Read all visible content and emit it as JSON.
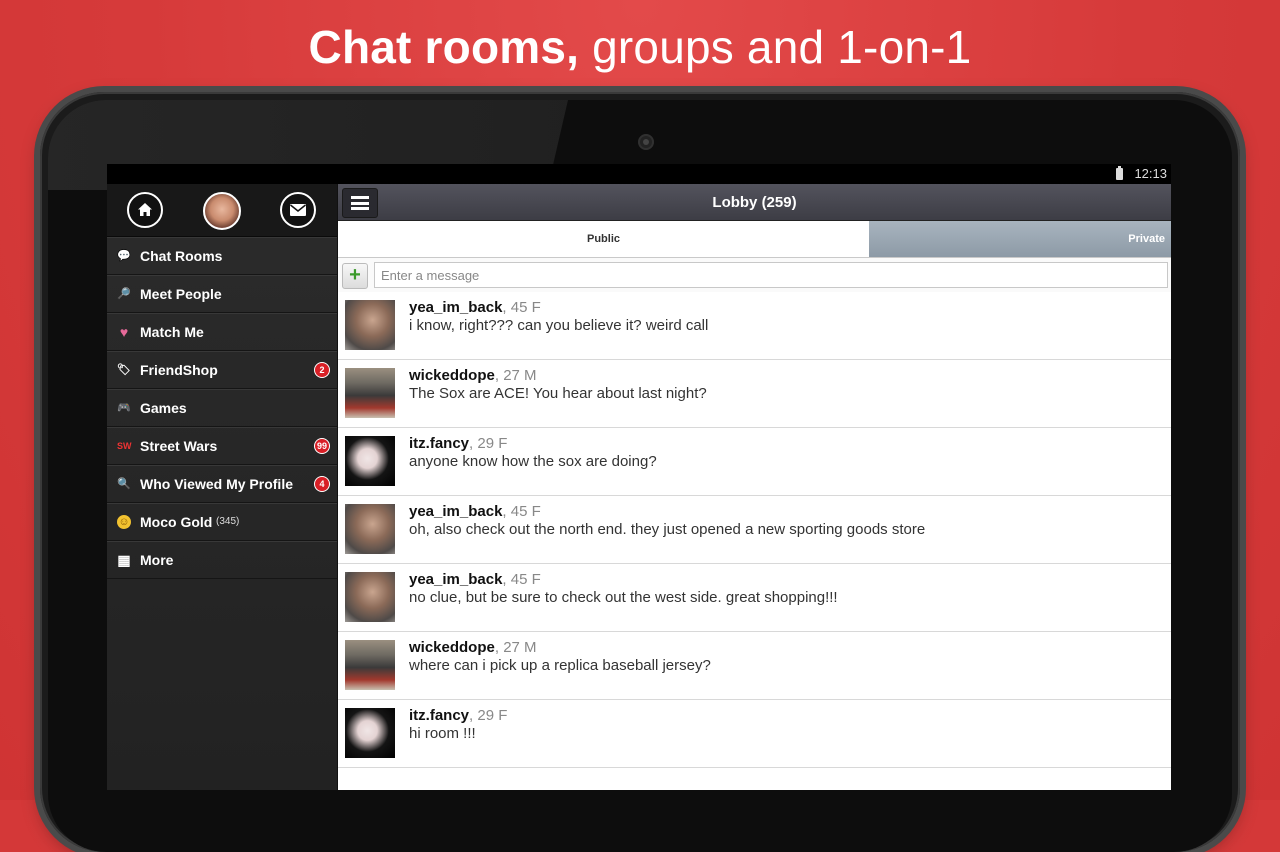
{
  "headline": {
    "bold": "Chat rooms,",
    "rest": " groups and 1-on-1"
  },
  "status": {
    "time": "12:13"
  },
  "sidebar": {
    "items": [
      {
        "label": "Chat Rooms",
        "icon": "speech-bubble-icon",
        "glyph": "💬",
        "badge": ""
      },
      {
        "label": "Meet People",
        "icon": "magnifier-icon",
        "glyph": "🔎",
        "badge": ""
      },
      {
        "label": "Match Me",
        "icon": "heart-icon",
        "glyph": "♥",
        "badge": ""
      },
      {
        "label": "FriendShop",
        "icon": "tag-icon",
        "glyph": "🏷",
        "badge": "2"
      },
      {
        "label": "Games",
        "icon": "gamepad-icon",
        "glyph": "🎮",
        "badge": ""
      },
      {
        "label": "Street Wars",
        "icon": "sw-logo-icon",
        "glyph": "SW",
        "badge": "99"
      },
      {
        "label": "Who Viewed My Profile",
        "icon": "viewer-icon",
        "glyph": "🔍",
        "badge": "4"
      },
      {
        "label": "Moco Gold",
        "sub": "(345)",
        "icon": "gold-coin-icon",
        "glyph": "☺",
        "badge": ""
      },
      {
        "label": "More",
        "icon": "grid-icon",
        "glyph": "▦",
        "badge": ""
      }
    ]
  },
  "main": {
    "title": "Lobby (259)",
    "tabs": {
      "public": "Public",
      "private": "Private"
    },
    "input_placeholder": "Enter a message"
  },
  "messages": [
    {
      "user": "yea_im_back",
      "meta": ", 45 F",
      "text": "i know, right??? can you believe it? weird call",
      "pic": "p1"
    },
    {
      "user": "wickeddope",
      "meta": ", 27 M",
      "text": "The Sox are ACE! You hear about last night?",
      "pic": "p2"
    },
    {
      "user": "itz.fancy",
      "meta": ", 29 F",
      "text": "anyone know how the sox are doing?",
      "pic": "p3"
    },
    {
      "user": "yea_im_back",
      "meta": ", 45 F",
      "text": "oh, also check out the north end. they just opened a new sporting goods store",
      "pic": "p1"
    },
    {
      "user": "yea_im_back",
      "meta": ", 45 F",
      "text": "no clue, but be sure to check out the west side. great shopping!!!",
      "pic": "p1"
    },
    {
      "user": "wickeddope",
      "meta": ", 27 M",
      "text": "where can i pick up a replica baseball jersey?",
      "pic": "p2"
    },
    {
      "user": "itz.fancy",
      "meta": ", 29 F",
      "text": "hi room !!!",
      "pic": "p3"
    }
  ],
  "colors": {
    "background": "#d63a3a",
    "badge": "#d81f26",
    "tab_private": "#95a2ae"
  }
}
